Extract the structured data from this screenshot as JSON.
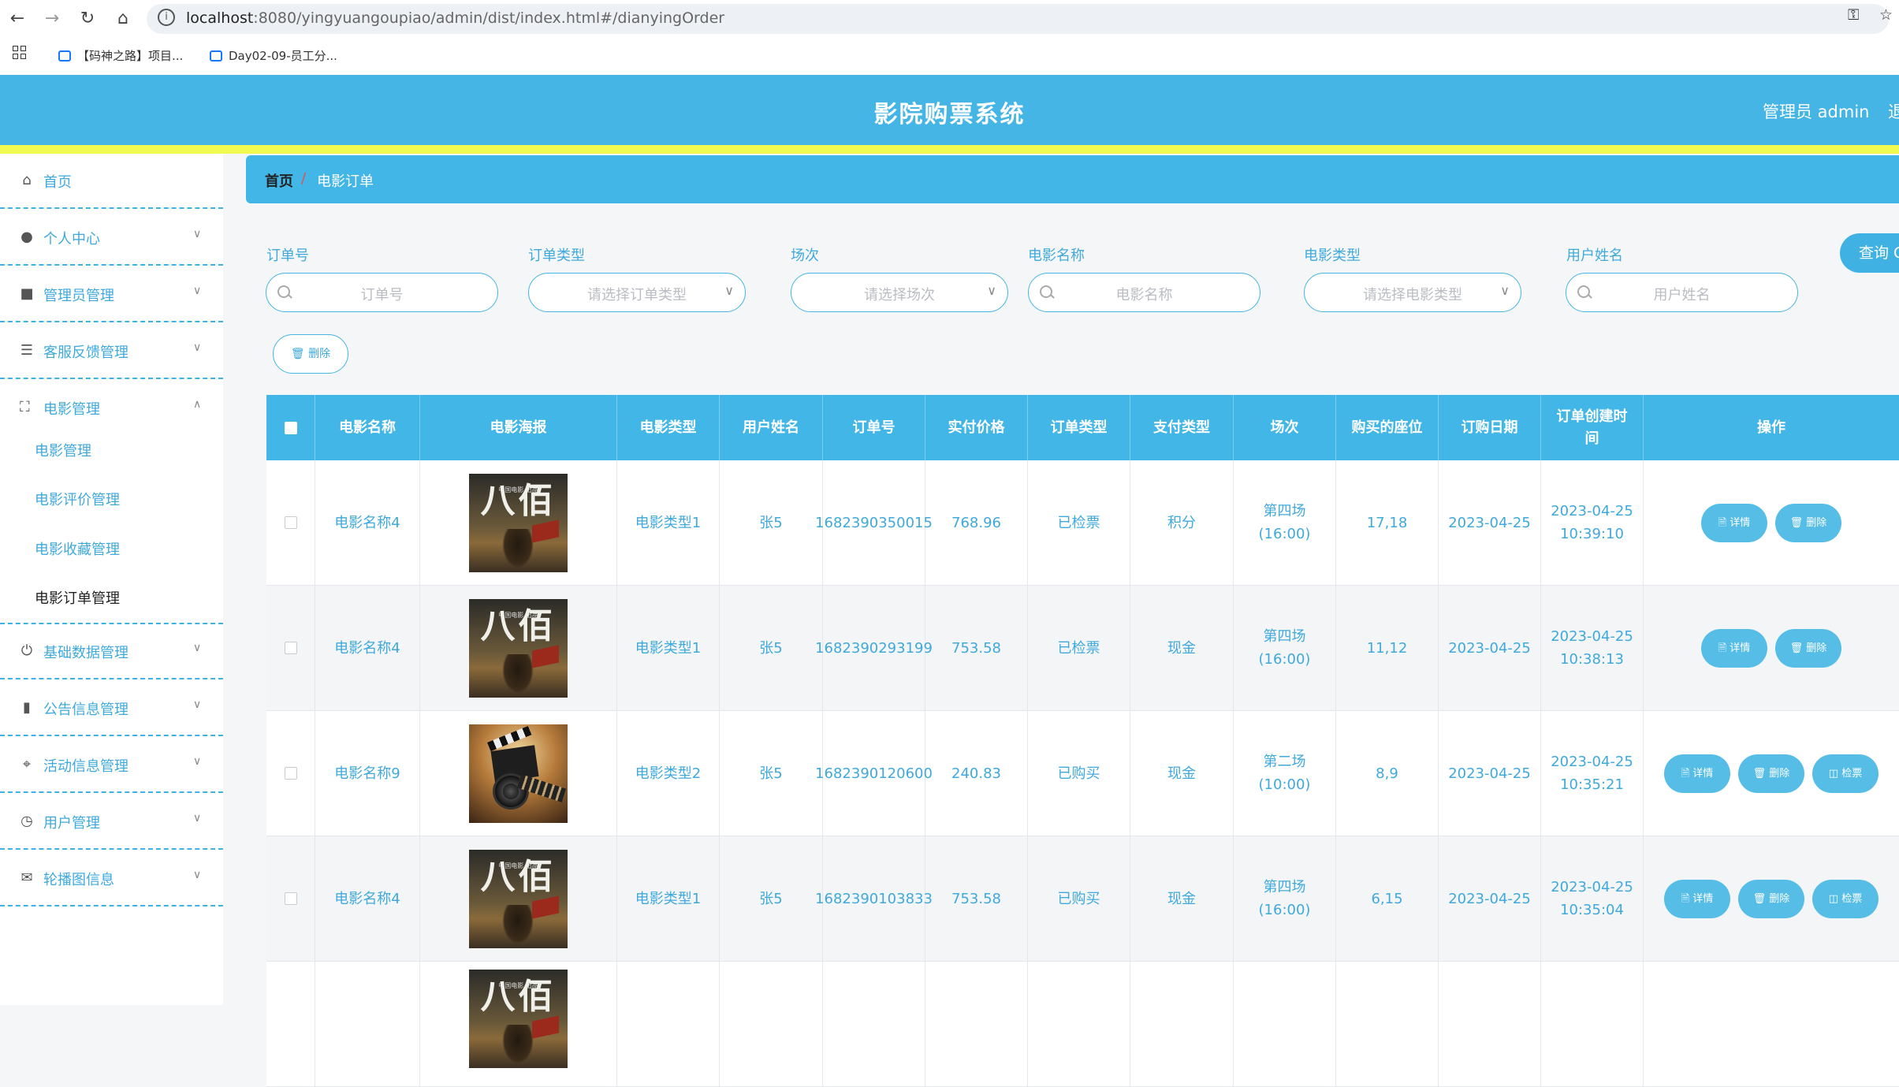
{
  "browser": {
    "url_host": "localhost",
    "url_rest": ":8080/yingyuangoupiao/admin/dist/index.html#/dianyingOrder",
    "bookmarks": [
      {
        "label": "【码神之路】项目..."
      },
      {
        "label": "Day02-09-员工分..."
      }
    ]
  },
  "header": {
    "title": "影院购票系统",
    "user": "管理员 admin",
    "logout": "退"
  },
  "sidebar": {
    "items": [
      {
        "label": "首页",
        "icon": "home-icon"
      },
      {
        "label": "个人中心",
        "icon": "user-icon"
      },
      {
        "label": "管理员管理",
        "icon": "admin-icon"
      },
      {
        "label": "客服反馈管理",
        "icon": "list-icon"
      },
      {
        "label": "电影管理",
        "icon": "expand-icon",
        "expanded": true
      },
      {
        "label": "基础数据管理",
        "icon": "power-icon"
      },
      {
        "label": "公告信息管理",
        "icon": "mic-icon"
      },
      {
        "label": "活动信息管理",
        "icon": "crop-icon"
      },
      {
        "label": "用户管理",
        "icon": "clock-icon"
      },
      {
        "label": "轮播图信息",
        "icon": "chat-icon"
      }
    ],
    "subitems": [
      {
        "label": "电影管理"
      },
      {
        "label": "电影评价管理"
      },
      {
        "label": "电影收藏管理"
      },
      {
        "label": "电影订单管理",
        "active": true
      }
    ]
  },
  "breadcrumb": {
    "home": "首页",
    "sep": "/",
    "current": "电影订单"
  },
  "filters": [
    {
      "label": "订单号",
      "placeholder": "订单号",
      "kind": "text"
    },
    {
      "label": "订单类型",
      "placeholder": "请选择订单类型",
      "kind": "select"
    },
    {
      "label": "场次",
      "placeholder": "请选择场次",
      "kind": "select"
    },
    {
      "label": "电影名称",
      "placeholder": "电影名称",
      "kind": "text"
    },
    {
      "label": "电影类型",
      "placeholder": "请选择电影类型",
      "kind": "select"
    },
    {
      "label": "用户姓名",
      "placeholder": "用户姓名",
      "kind": "text"
    }
  ],
  "buttons": {
    "query": "查询 Q",
    "delete_batch": "🗑 删除",
    "detail": "🗎 详情",
    "delete": "🗑 删除",
    "check": "◫ 检票"
  },
  "table": {
    "columns": [
      "",
      "电影名称",
      "电影海报",
      "电影类型",
      "用户姓名",
      "订单号",
      "实付价格",
      "订单类型",
      "支付类型",
      "场次",
      "购买的座位",
      "订购日期",
      "订单创建时间",
      "操作"
    ],
    "rows": [
      {
        "name": "电影名称4",
        "poster": "poster-babai",
        "type": "电影类型1",
        "user": "张5",
        "order_no": "1682390350015",
        "price": "768.96",
        "order_type": "已检票",
        "pay_type": "积分",
        "session": "第四场(16:00)",
        "seats": "17,18",
        "date": "2023-04-25",
        "created": "2023-04-25 10:39:10",
        "can_check": false
      },
      {
        "name": "电影名称4",
        "poster": "poster-babai",
        "type": "电影类型1",
        "user": "张5",
        "order_no": "1682390293199",
        "price": "753.58",
        "order_type": "已检票",
        "pay_type": "现金",
        "session": "第四场(16:00)",
        "seats": "11,12",
        "date": "2023-04-25",
        "created": "2023-04-25 10:38:13",
        "can_check": false
      },
      {
        "name": "电影名称9",
        "poster": "poster-clapper",
        "type": "电影类型2",
        "user": "张5",
        "order_no": "1682390120600",
        "price": "240.83",
        "order_type": "已购买",
        "pay_type": "现金",
        "session": "第二场(10:00)",
        "seats": "8,9",
        "date": "2023-04-25",
        "created": "2023-04-25 10:35:21",
        "can_check": true
      },
      {
        "name": "电影名称4",
        "poster": "poster-babai",
        "type": "电影类型1",
        "user": "张5",
        "order_no": "1682390103833",
        "price": "753.58",
        "order_type": "已购买",
        "pay_type": "现金",
        "session": "第四场(16:00)",
        "seats": "6,15",
        "date": "2023-04-25",
        "created": "2023-04-25 10:35:04",
        "can_check": true
      }
    ],
    "poster_text": "八佰",
    "poster_small": "中国电影 出品"
  },
  "colors": {
    "primary": "#44b5e5",
    "accent_bar": "#f0fa50",
    "text_link": "#3fa9dc"
  }
}
